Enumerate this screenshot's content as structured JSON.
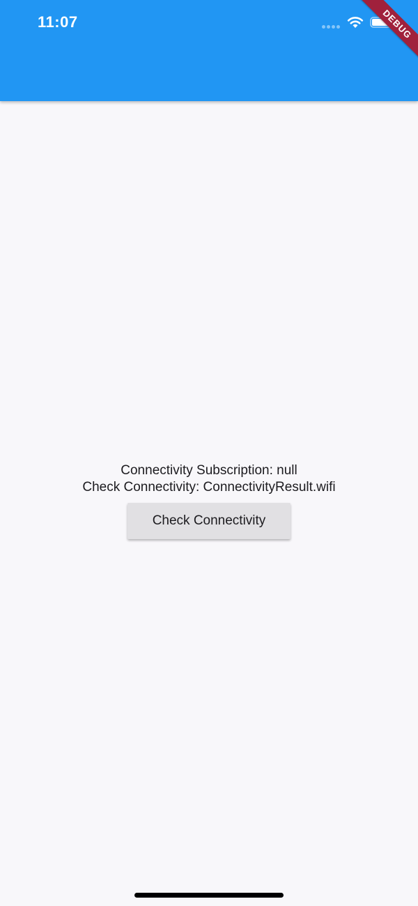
{
  "status_bar": {
    "time": "11:07",
    "icons": [
      "signal-dots-icon",
      "wifi-icon",
      "battery-icon"
    ]
  },
  "debug_banner": {
    "label": "DEBUG",
    "color": "#a0213c"
  },
  "app_bar": {
    "color": "#2196f3"
  },
  "main": {
    "subscription_text": "Connectivity Subscription: null",
    "check_text": "Check Connectivity: ConnectivityResult.wifi",
    "check_button_label": "Check Connectivity"
  },
  "colors": {
    "background": "#f8f7fa",
    "button": "#e1e0e3",
    "text": "#1c1b1f"
  }
}
